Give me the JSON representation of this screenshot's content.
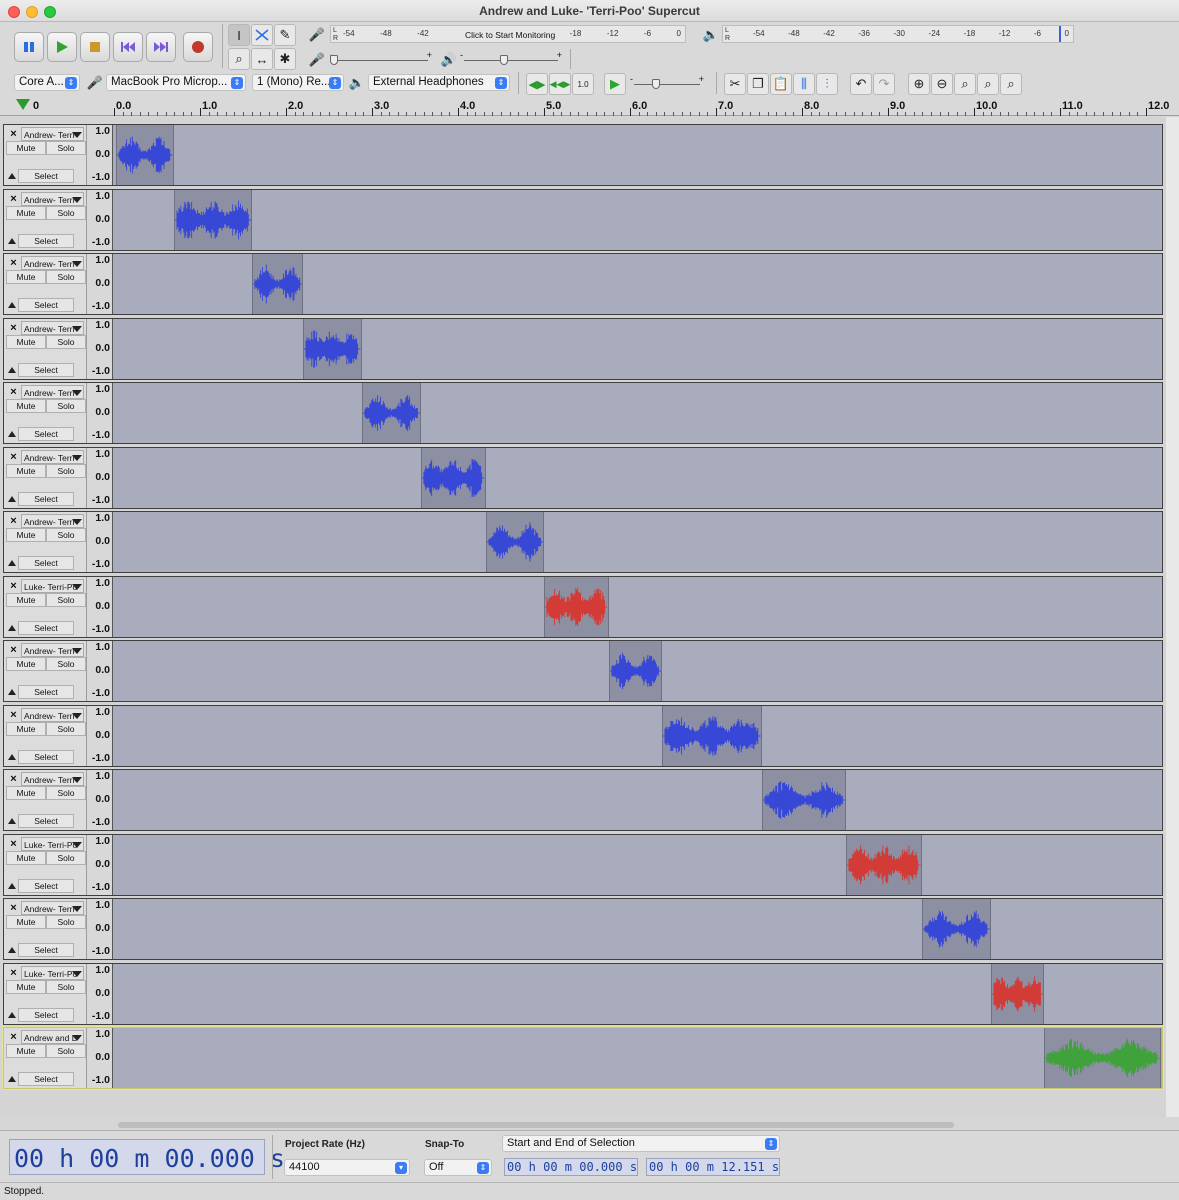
{
  "window": {
    "title": "Andrew and Luke- 'Terri-Poo' Supercut"
  },
  "transport": {
    "buttons": [
      "pause",
      "play",
      "stop",
      "skip-to-start",
      "skip-to-end",
      "record"
    ]
  },
  "meters": {
    "record_scale": [
      "-54",
      "-48",
      "-42",
      "",
      "-18",
      "-12",
      "-6",
      "0"
    ],
    "record_message": "Click to Start Monitoring",
    "playback_scale": [
      "-54",
      "-48",
      "-42",
      "-36",
      "-30",
      "-24",
      "-18",
      "-12",
      "-6",
      "0"
    ],
    "channels": "L\nR"
  },
  "mixer": {
    "record_minus": "-",
    "record_plus": "+",
    "play_minus": "-",
    "play_plus": "+"
  },
  "device": {
    "host": "Core A...",
    "input": "MacBook Pro Microp...",
    "channels": "1 (Mono) Re...",
    "output": "External Headphones"
  },
  "play_at_speed": {
    "minus": "-",
    "plus": "+",
    "value": "1.0"
  },
  "ruler": {
    "labels": [
      "0.0",
      "1.0",
      "2.0",
      "3.0",
      "4.0",
      "5.0",
      "6.0",
      "7.0",
      "8.0",
      "9.0",
      "10.0",
      "11.0",
      "12.0"
    ],
    "zero_marker": "0"
  },
  "track_labels": {
    "mute": "Mute",
    "solo": "Solo",
    "select": "Select",
    "close": "×",
    "scale_top": "1.0",
    "scale_mid": "0.0",
    "scale_bot": "-1.0"
  },
  "tracks": [
    {
      "name": "Andrew- Terri-",
      "color": "#3848d6",
      "clip_start": 0.0,
      "clip_end": 0.67
    },
    {
      "name": "Andrew- Terri-",
      "color": "#3848d6",
      "clip_start": 0.67,
      "clip_end": 1.58
    },
    {
      "name": "Andrew- Terri-",
      "color": "#3848d6",
      "clip_start": 1.58,
      "clip_end": 2.18
    },
    {
      "name": "Andrew- Terri-",
      "color": "#3848d6",
      "clip_start": 2.18,
      "clip_end": 2.86
    },
    {
      "name": "Andrew- Terri-",
      "color": "#3848d6",
      "clip_start": 2.86,
      "clip_end": 3.55
    },
    {
      "name": "Andrew- Terri-",
      "color": "#3848d6",
      "clip_start": 3.55,
      "clip_end": 4.3
    },
    {
      "name": "Andrew- Terri-",
      "color": "#3848d6",
      "clip_start": 4.3,
      "clip_end": 4.98
    },
    {
      "name": "Luke- Terri-Po",
      "color": "#d23b36",
      "clip_start": 4.98,
      "clip_end": 5.73
    },
    {
      "name": "Andrew- Terri-",
      "color": "#3848d6",
      "clip_start": 5.73,
      "clip_end": 6.35
    },
    {
      "name": "Andrew- Terri-",
      "color": "#3848d6",
      "clip_start": 6.35,
      "clip_end": 7.51
    },
    {
      "name": "Andrew- Terri-",
      "color": "#3848d6",
      "clip_start": 7.51,
      "clip_end": 8.49
    },
    {
      "name": "Luke- Terri-Po",
      "color": "#d23b36",
      "clip_start": 8.49,
      "clip_end": 9.37
    },
    {
      "name": "Andrew- Terri-",
      "color": "#3848d6",
      "clip_start": 9.37,
      "clip_end": 10.17
    },
    {
      "name": "Luke- Terri-Po",
      "color": "#d23b36",
      "clip_start": 10.17,
      "clip_end": 10.79
    },
    {
      "name": "Andrew and L",
      "color": "#3fa23a",
      "clip_start": 10.79,
      "clip_end": 12.15,
      "selected": true
    }
  ],
  "selection_toolbar": {
    "audio_position": "00 h 00 m 00.000 s",
    "project_rate_label": "Project Rate (Hz)",
    "project_rate": "44100",
    "snap_to_label": "Snap-To",
    "snap_to": "Off",
    "selection_mode": "Start and End of Selection",
    "start": "00 h 00 m 00.000 s",
    "end": "00 h 00 m 12.151 s"
  },
  "status": "Stopped."
}
